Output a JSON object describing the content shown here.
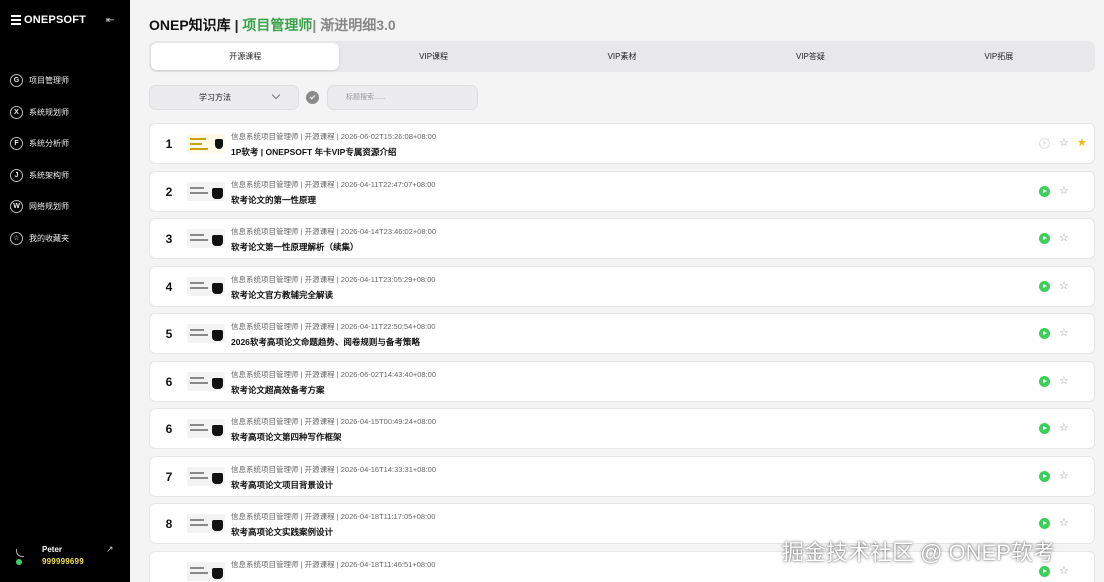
{
  "brand": {
    "name": "ONEPSOFT"
  },
  "sidebar": {
    "items": [
      {
        "badge": "G",
        "label": "项目管理师"
      },
      {
        "badge": "X",
        "label": "系统规划师"
      },
      {
        "badge": "F",
        "label": "系统分析师"
      },
      {
        "badge": "J",
        "label": "系统架构师"
      },
      {
        "badge": "W",
        "label": "网络规划师"
      },
      {
        "badge": "☆",
        "label": "我的收藏夹"
      }
    ]
  },
  "user": {
    "name": "Peter",
    "credits": "999999699"
  },
  "header": {
    "title": "ONEP知识库",
    "sep": " | ",
    "role": "项目管理师",
    "subtitle": "| 渐进明细3.0"
  },
  "tabs": [
    {
      "label": "开源课程",
      "active": true
    },
    {
      "label": "VIP课程",
      "active": false
    },
    {
      "label": "VIP素材",
      "active": false
    },
    {
      "label": "VIP答疑",
      "active": false
    },
    {
      "label": "VIP拓展",
      "active": false
    }
  ],
  "filters": {
    "category_value": "学习方法",
    "search_placeholder": "标题搜索......"
  },
  "rows": [
    {
      "index": "1",
      "meta": "信息系统项目管理师 | 开源课程 | 2026-06-02T15:26:08+08:00",
      "title": "1P软考 | ONEPSOFT 年卡VIP专属资源介绍",
      "playable": false,
      "favorited": true
    },
    {
      "index": "2",
      "meta": "信息系统项目管理师 | 开源课程 | 2026-04-11T22:47:07+08:00",
      "title": "软考论文的第一性原理",
      "playable": true,
      "favorited": false
    },
    {
      "index": "3",
      "meta": "信息系统项目管理师 | 开源课程 | 2026-04-14T23:46:02+08:00",
      "title": "软考论文第一性原理解析（续集）",
      "playable": true,
      "favorited": false
    },
    {
      "index": "4",
      "meta": "信息系统项目管理师 | 开源课程 | 2026-04-11T23:05:29+08:00",
      "title": "软考论文官方教辅完全解读",
      "playable": true,
      "favorited": false
    },
    {
      "index": "5",
      "meta": "信息系统项目管理师 | 开源课程 | 2026-04-11T22:50:54+08:00",
      "title": "2026软考高项论文命题趋势、阅卷规则与备考策略",
      "playable": true,
      "favorited": false
    },
    {
      "index": "6",
      "meta": "信息系统项目管理师 | 开源课程 | 2026-06-02T14:43:40+08:00",
      "title": "软考论文超高效备考方案",
      "playable": true,
      "favorited": false
    },
    {
      "index": "6",
      "meta": "信息系统项目管理师 | 开源课程 | 2026-04-15T00:49:24+08:00",
      "title": "软考高项论文第四种写作框架",
      "playable": true,
      "favorited": false
    },
    {
      "index": "7",
      "meta": "信息系统项目管理师 | 开源课程 | 2026-04-16T14:33:31+08:00",
      "title": "软考高项论文项目背景设计",
      "playable": true,
      "favorited": false
    },
    {
      "index": "8",
      "meta": "信息系统项目管理师 | 开源课程 | 2026-04-18T11:17:05+08:00",
      "title": "软考高项论文实践案例设计",
      "playable": true,
      "favorited": false
    },
    {
      "index": "",
      "meta": "信息系统项目管理师 | 开源课程 | 2026-04-18T11:46:51+08:00",
      "title": "",
      "playable": true,
      "favorited": false
    }
  ],
  "watermark": "掘金技术社区 @ ONEP软考",
  "colors": {
    "accent_green": "#3aa34a",
    "play_green": "#3ccf5a",
    "star_gold": "#f2b705",
    "sidebar_bg": "#000000"
  }
}
